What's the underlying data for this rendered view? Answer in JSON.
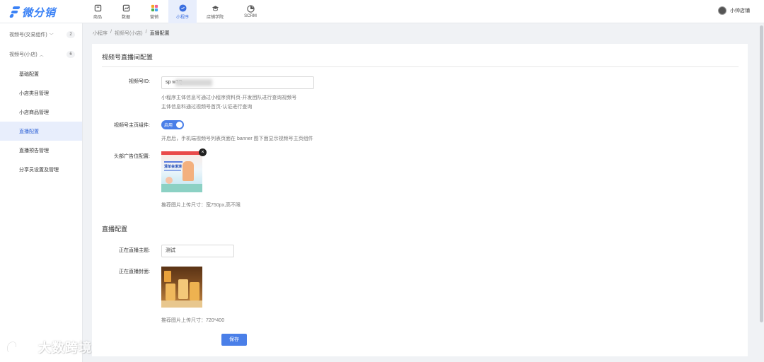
{
  "brand": {
    "name": "微分销",
    "color": "#3b82f6"
  },
  "nav": [
    {
      "label": "商品",
      "icon": "goods-icon"
    },
    {
      "label": "数据",
      "icon": "data-icon"
    },
    {
      "label": "营销",
      "icon": "marketing-icon"
    },
    {
      "label": "小程序",
      "icon": "miniprogram-icon",
      "active": true
    },
    {
      "label": "店铺学院",
      "icon": "academy-icon"
    },
    {
      "label": "SCRM",
      "icon": "scrm-icon"
    }
  ],
  "user": {
    "name": "小帅店铺"
  },
  "sidebar": {
    "group1": {
      "label": "视频号(交易组件)",
      "count": "2"
    },
    "group2": {
      "label": "视频号(小店)",
      "count": "6"
    },
    "items": [
      {
        "label": "基础配置"
      },
      {
        "label": "小店类目管理"
      },
      {
        "label": "小店商品管理"
      },
      {
        "label": "直播配置",
        "active": true
      },
      {
        "label": "直播预告管理"
      },
      {
        "label": "分享员设置及管理"
      }
    ]
  },
  "breadcrumb": {
    "a": "小程序",
    "b": "视频号(小店)",
    "c": "直播配置"
  },
  "section1": {
    "title": "视频号直播间配置",
    "id_label": "视频号ID:",
    "id_value": "sp          w7Q",
    "id_hint1": "小程序主体信息可通过小程序资料页-开发团队进行查询视频号",
    "id_hint2": "主体信息科通过视频号首页-认证进行查询",
    "component_label": "视频号主页组件:",
    "toggle_text": "启用",
    "component_hint": "开启后，手机端视频号列表页面在 banner 图下面显示视频号主页组件",
    "ad_label": "头部广告位配置:",
    "ad_hint": "推荐图片上传尺寸：宽750px,高不限",
    "ad_banner_text": "清单会滚滚"
  },
  "section2": {
    "title": "直播配置",
    "topic_label": "正在直播主题:",
    "topic_value": "测试",
    "cover_label": "正在直播封面:",
    "cover_hint": "推荐图片上传尺寸：720*400"
  },
  "save_label": "保存",
  "watermark": "大数跨境"
}
